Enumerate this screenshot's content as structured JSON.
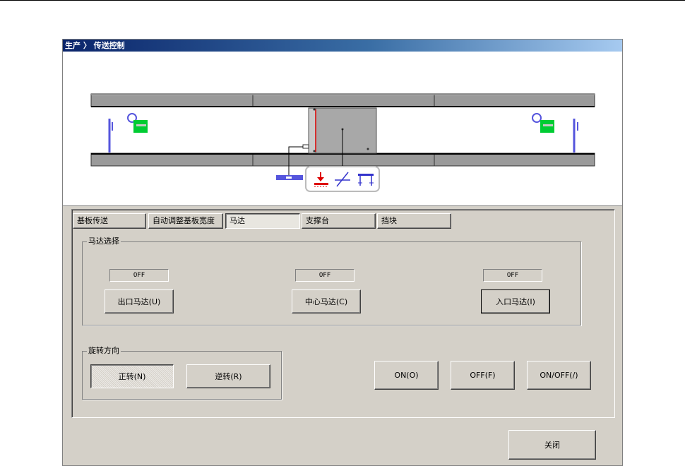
{
  "window": {
    "title": "生产 〉 传送控制"
  },
  "tabs": [
    {
      "label": "基板传送"
    },
    {
      "label": "自动调整基板宽度"
    },
    {
      "label": "马达"
    },
    {
      "label": "支撑台"
    },
    {
      "label": "挡块"
    }
  ],
  "active_tab": "马达",
  "motor_select": {
    "title": "马达选择",
    "motors": [
      {
        "status": "OFF",
        "label": "出口马达(U)"
      },
      {
        "status": "OFF",
        "label": "中心马达(C)"
      },
      {
        "status": "OFF",
        "label": "入口马达(I)"
      }
    ]
  },
  "rotation": {
    "title": "旋转方向",
    "forward_label": "正转(N)",
    "reverse_label": "逆转(R)",
    "selected": "正转(N)"
  },
  "actions": {
    "on_label": "ON(O)",
    "off_label": "OFF(F)",
    "onoff_label": "ON/OFF(/)"
  },
  "close_label": "关闭",
  "colors": {
    "sensor": "#5555dd",
    "stopper": "#00cc33",
    "warning": "#dd0000",
    "rail": "#9a9a9a"
  }
}
